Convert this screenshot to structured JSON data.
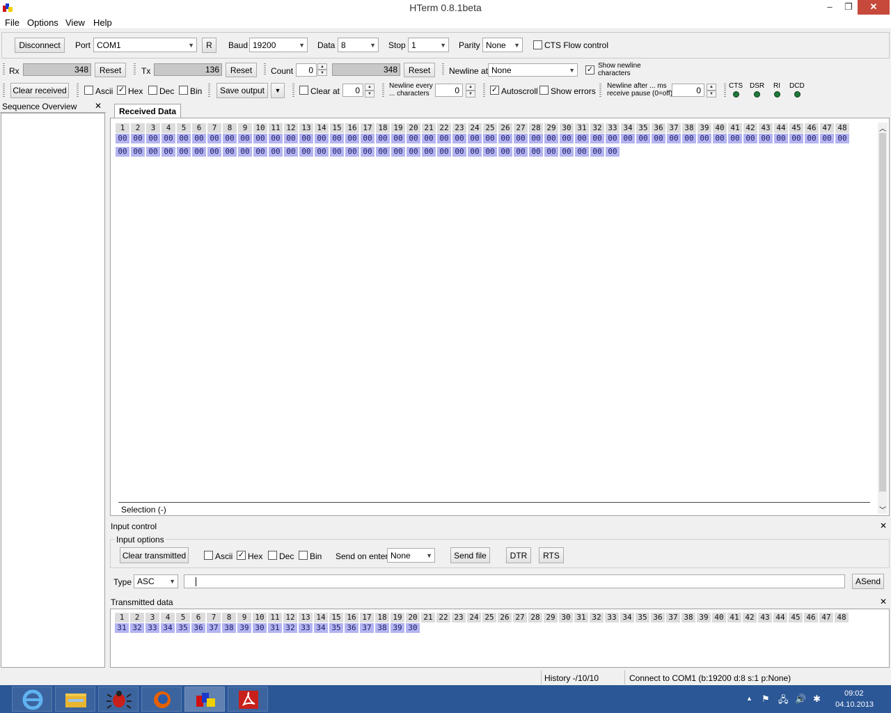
{
  "window": {
    "title": "HTerm 0.8.1beta",
    "minimize": "–",
    "restore": "❐",
    "close": "✕"
  },
  "menu": [
    "File",
    "Options",
    "View",
    "Help"
  ],
  "connection": {
    "disconnect": "Disconnect",
    "port_label": "Port",
    "port": "COM1",
    "refresh": "R",
    "baud_label": "Baud",
    "baud": "19200",
    "data_label": "Data",
    "data": "8",
    "stop_label": "Stop",
    "stop": "1",
    "parity_label": "Parity",
    "parity": "None",
    "cts_label": "CTS Flow control"
  },
  "counters": {
    "rx_label": "Rx",
    "rx_value": "348",
    "rx_reset": "Reset",
    "tx_label": "Tx",
    "tx_value": "136",
    "tx_reset": "Reset",
    "count_label": "Count",
    "count_value": "0",
    "count_total": "348",
    "count_reset": "Reset",
    "newline_at_label": "Newline at",
    "newline_at": "None",
    "show_newline_line1": "Show newline",
    "show_newline_line2": "characters"
  },
  "receive_opts": {
    "clear_received": "Clear received",
    "ascii": "Ascii",
    "hex": "Hex",
    "dec": "Dec",
    "bin": "Bin",
    "save_output": "Save output",
    "clear_at": "Clear at",
    "clear_at_value": "0",
    "newline_every_line1": "Newline every",
    "newline_every_line2": "... characters",
    "newline_every_value": "0",
    "autoscroll": "Autoscroll",
    "show_errors": "Show errors",
    "newline_after_line1": "Newline after ... ms",
    "newline_after_line2": "receive pause (0=off)",
    "newline_after_value": "0",
    "lines": [
      "CTS",
      "DSR",
      "RI",
      "DCD"
    ]
  },
  "sequence": {
    "title": "Sequence Overview",
    "close": "✕"
  },
  "received": {
    "tab": "Received Data",
    "selection": "Selection (-)",
    "row1": [
      "00",
      "00",
      "00",
      "00",
      "00",
      "00",
      "00",
      "00",
      "00",
      "00",
      "00",
      "00",
      "00",
      "00",
      "00",
      "00",
      "00",
      "00",
      "00",
      "00",
      "00",
      "00",
      "00",
      "00",
      "00",
      "00",
      "00",
      "00",
      "00",
      "00",
      "00",
      "00",
      "00",
      "00",
      "00",
      "00",
      "00",
      "00",
      "00",
      "00",
      "00",
      "00",
      "00",
      "00",
      "00",
      "00",
      "00",
      "00"
    ],
    "row2": [
      "00",
      "00",
      "00",
      "00",
      "00",
      "00",
      "00",
      "00",
      "00",
      "00",
      "00",
      "00",
      "00",
      "00",
      "00",
      "00",
      "00",
      "00",
      "00",
      "00",
      "00",
      "00",
      "00",
      "00",
      "00",
      "00",
      "00",
      "00",
      "00",
      "00",
      "00",
      "00",
      "00"
    ]
  },
  "input_control": {
    "title": "Input control",
    "close": "✕",
    "options_label": "Input options",
    "clear_transmitted": "Clear transmitted",
    "ascii": "Ascii",
    "hex": "Hex",
    "dec": "Dec",
    "bin": "Bin",
    "send_on_enter_label": "Send on enter",
    "send_on_enter": "None",
    "send_file": "Send file",
    "dtr": "DTR",
    "rts": "RTS",
    "type_label": "Type",
    "type_value": "ASC",
    "input_value": "",
    "asend": "ASend"
  },
  "transmitted": {
    "title": "Transmitted data",
    "close": "✕",
    "row1": [
      "31",
      "32",
      "33",
      "34",
      "35",
      "36",
      "37",
      "38",
      "39",
      "30",
      "31",
      "32",
      "33",
      "34",
      "35",
      "36",
      "37",
      "38",
      "39",
      "30"
    ]
  },
  "status": {
    "history": "History -/10/10",
    "connection": "Connect to COM1 (b:19200 d:8 s:1 p:None)"
  },
  "taskbar": {
    "apps": [
      "internet-explorer-icon",
      "file-explorer-icon",
      "bug-app-icon",
      "firefox-icon",
      "hterm-icon",
      "acrobat-icon"
    ],
    "time": "09:02",
    "date": "04.10.2013",
    "accent": "#2b5797"
  }
}
